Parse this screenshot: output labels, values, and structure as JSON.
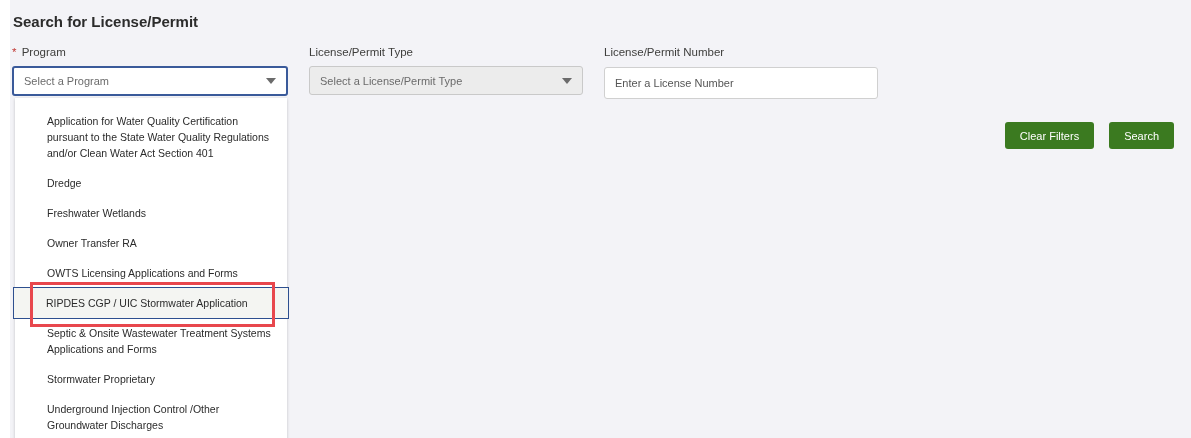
{
  "title": "Search for License/Permit",
  "fields": [
    {
      "kind": "select",
      "required_mark": "*",
      "label": "Program",
      "placeholder": "Select a Program",
      "open": true
    },
    {
      "kind": "select",
      "label": "License/Permit Type",
      "placeholder": "Select a License/Permit Type",
      "disabled": true
    },
    {
      "kind": "text",
      "label": "License/Permit Number",
      "placeholder": "Enter a License Number"
    }
  ],
  "program_options": [
    {
      "label": "Application for Water Quality Certification pursuant to the State Water Quality Regulations and/or Clean Water Act Section 401",
      "selected": false,
      "highlighted": false
    },
    {
      "label": "Dredge",
      "selected": false,
      "highlighted": false
    },
    {
      "label": "Freshwater Wetlands",
      "selected": false,
      "highlighted": false
    },
    {
      "label": "Owner Transfer RA",
      "selected": false,
      "highlighted": false
    },
    {
      "label": "OWTS Licensing Applications and Forms",
      "selected": false,
      "highlighted": false
    },
    {
      "label": "RIPDES CGP / UIC Stormwater Application",
      "selected": true,
      "highlighted": true
    },
    {
      "label": "Septic & Onsite Wastewater Treatment Systems Applications and Forms",
      "selected": false,
      "highlighted": false
    },
    {
      "label": "Stormwater Proprietary",
      "selected": false,
      "highlighted": false
    },
    {
      "label": "Underground Injection Control /Other Groundwater Discharges",
      "selected": false,
      "highlighted": false
    }
  ],
  "buttons": [
    "Clear Filters",
    "Search"
  ]
}
